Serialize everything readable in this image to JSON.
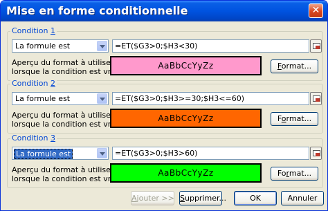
{
  "window": {
    "title": "Mise en forme conditionnelle",
    "close_glyph": "✕"
  },
  "conditions": [
    {
      "legend_prefix": "Condition ",
      "legend_number": "1",
      "type": "La formule est",
      "type_selected": false,
      "formula": "=ET($G3>0;$H3<30)",
      "desc_line1": "Aperçu du format à utiliser",
      "desc_line2": "lorsque la condition est vraie :",
      "preview_text": "AaBbCcYyZz",
      "preview_bg": "#FF99CC",
      "format_prefix": "",
      "format_mnemonic": "F",
      "format_suffix": "ormat..."
    },
    {
      "legend_prefix": "Condition ",
      "legend_number": "2",
      "type": "La formule est",
      "type_selected": false,
      "formula": "=ET($G3>0;$H3>=30;$H3<=60)",
      "desc_line1": "Aperçu du format à utiliser",
      "desc_line2": "lorsque la condition est vraie :",
      "preview_text": "AaBbCcYyZz",
      "preview_bg": "#FF6600",
      "format_prefix": "F",
      "format_mnemonic": "o",
      "format_suffix": "rmat..."
    },
    {
      "legend_prefix": "Condition ",
      "legend_number": "3",
      "type": "La formule est",
      "type_selected": true,
      "formula": "=ET($G3>0;$H3>60)",
      "desc_line1": "Aperçu du format à utiliser",
      "desc_line2": "lorsque la condition est vraie :",
      "preview_text": "AaBbCcYyZz",
      "preview_bg": "#00FF00",
      "format_prefix": "Fo",
      "format_mnemonic": "r",
      "format_suffix": "mat..."
    }
  ],
  "buttons": {
    "add": {
      "prefix": "",
      "mnemonic": "A",
      "suffix": "jouter >>"
    },
    "delete": {
      "prefix": "",
      "mnemonic": "S",
      "suffix": "upprimer..."
    },
    "ok": "OK",
    "cancel": "Annuler"
  }
}
